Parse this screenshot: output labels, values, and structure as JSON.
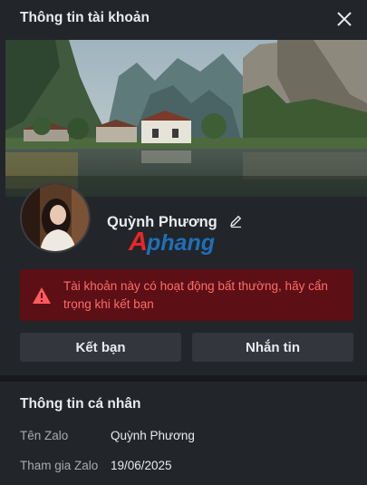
{
  "dialog": {
    "title": "Thông tin tài khoản",
    "close_icon": "close-icon"
  },
  "profile": {
    "name": "Quỳnh Phương",
    "edit_icon": "pencil-icon",
    "watermark_text": "Aphang"
  },
  "warning": {
    "icon": "warning-triangle-icon",
    "text": "Tài khoản này có hoạt động bất thường, hãy cẩn trọng khi kết bạn"
  },
  "actions": {
    "add_friend_label": "Kết bạn",
    "message_label": "Nhắn tin"
  },
  "personal_info": {
    "section_title": "Thông tin cá nhân",
    "rows": [
      {
        "label": "Tên Zalo",
        "value": "Quỳnh Phương"
      },
      {
        "label": "Tham gia Zalo",
        "value": "19/06/2025"
      }
    ]
  },
  "colors": {
    "background": "#222529",
    "warning_bg": "#5c1015",
    "warning_text": "#ff6b6b",
    "button_bg": "#33373d",
    "watermark_red": "#e8272b",
    "watermark_blue": "#1f6fb8"
  }
}
